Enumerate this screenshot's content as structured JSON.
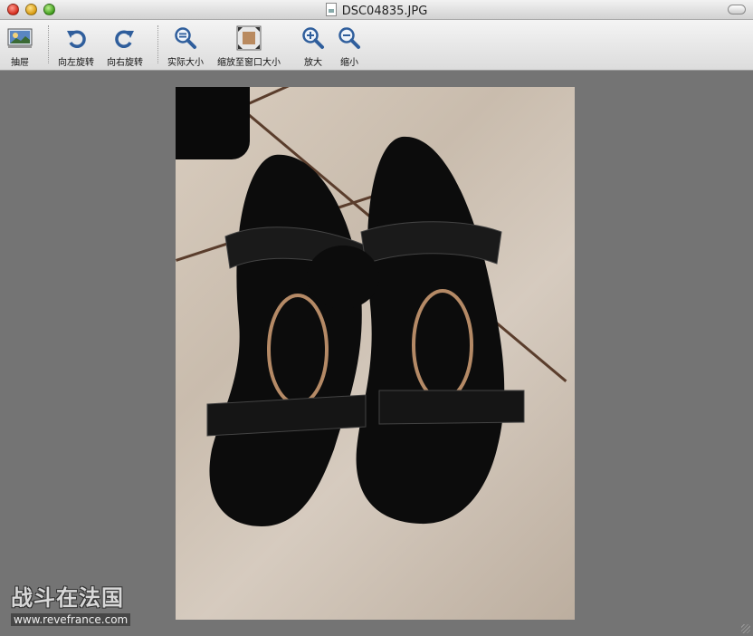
{
  "window": {
    "title": "DSC04835.JPG"
  },
  "toolbar": {
    "items": [
      {
        "label": "抽屉",
        "icon": "drawer-icon"
      },
      {
        "label": "向左旋转",
        "icon": "rotate-left-icon"
      },
      {
        "label": "向右旋转",
        "icon": "rotate-right-icon"
      },
      {
        "label": "实际大小",
        "icon": "actual-size-icon"
      },
      {
        "label": "缩放至窗口大小",
        "icon": "zoom-to-fit-icon"
      },
      {
        "label": "放大",
        "icon": "zoom-in-icon"
      },
      {
        "label": "缩小",
        "icon": "zoom-out-icon"
      }
    ]
  },
  "watermark": {
    "title": "战斗在法国",
    "url": "www.revefrance.com"
  },
  "colors": {
    "accent": "#3a5f9a",
    "canvas": "#747474"
  }
}
